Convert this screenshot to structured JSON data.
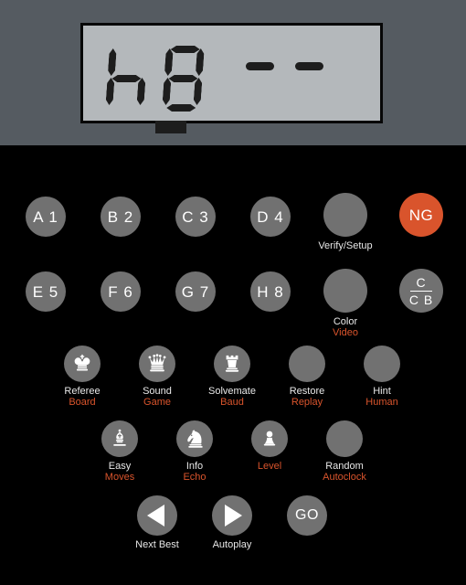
{
  "device": {
    "name": "chess-computer-control-panel",
    "bezel_color": "#555b61",
    "body_color": "#000000",
    "accent_color": "#d9542c",
    "button_color": "#717171",
    "lcd_bg_color": "#b4b8bb",
    "lcd_segment_color": "#1d1d1d"
  },
  "display": {
    "name": "lcd-display",
    "text": "h8  - -",
    "square_field": "h8",
    "file_char": "h",
    "rank_digit": "8",
    "dash_count": 2,
    "indicator_block_visible": true
  },
  "keypad": {
    "coordinate_row_1": [
      {
        "label": "A 1",
        "caption_white": "",
        "caption_orange": ""
      },
      {
        "label": "B 2",
        "caption_white": "",
        "caption_orange": ""
      },
      {
        "label": "C 3",
        "caption_white": "",
        "caption_orange": ""
      },
      {
        "label": "D 4",
        "caption_white": "",
        "caption_orange": ""
      }
    ],
    "coordinate_row_2": [
      {
        "label": "E 5",
        "caption_white": "",
        "caption_orange": ""
      },
      {
        "label": "F 6",
        "caption_white": "",
        "caption_orange": ""
      },
      {
        "label": "G 7",
        "caption_white": "",
        "caption_orange": ""
      },
      {
        "label": "H 8",
        "caption_white": "",
        "caption_orange": ""
      }
    ],
    "verify_setup": {
      "label": "",
      "caption_white": "Verify/Setup",
      "caption_orange": ""
    },
    "new_game": {
      "label": "NG",
      "caption_white": "",
      "caption_orange": ""
    },
    "color_video": {
      "label": "",
      "caption_white": "Color",
      "caption_orange": "Video"
    },
    "c_cb": {
      "numerator": "C",
      "denominator": "C B",
      "caption_white": "",
      "caption_orange": ""
    },
    "function_row_1": [
      {
        "icon": "chess-king-icon",
        "caption_white": "Referee",
        "caption_orange": "Board"
      },
      {
        "icon": "chess-queen-icon",
        "caption_white": "Sound",
        "caption_orange": "Game"
      },
      {
        "icon": "chess-rook-icon",
        "caption_white": "Solvemate",
        "caption_orange": "Baud"
      },
      {
        "icon": "",
        "caption_white": "Restore",
        "caption_orange": "Replay"
      },
      {
        "icon": "",
        "caption_white": "Hint",
        "caption_orange": "Human"
      }
    ],
    "function_row_2": [
      {
        "icon": "chess-bishop-icon",
        "caption_white": "Easy",
        "caption_orange": "Moves"
      },
      {
        "icon": "chess-knight-icon",
        "caption_white": "Info",
        "caption_orange": "Echo"
      },
      {
        "icon": "chess-pawn-icon",
        "caption_white": "",
        "caption_orange": "Level"
      },
      {
        "icon": "",
        "caption_white": "Random",
        "caption_orange": "Autoclock"
      }
    ],
    "transport_row": [
      {
        "icon": "triangle-left-icon",
        "caption_white": "Next Best",
        "caption_orange": ""
      },
      {
        "icon": "triangle-right-icon",
        "caption_white": "Autoplay",
        "caption_orange": ""
      },
      {
        "icon": "",
        "label": "GO",
        "caption_white": "",
        "caption_orange": ""
      }
    ]
  }
}
